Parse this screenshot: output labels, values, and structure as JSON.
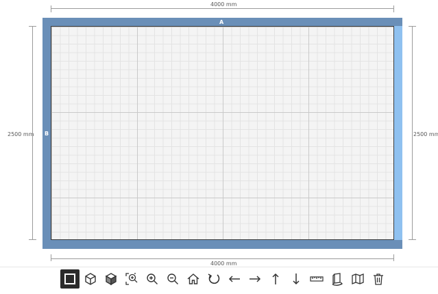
{
  "dimensions": {
    "top": "4000 mm",
    "bottom": "4000 mm",
    "left": "2500 mm",
    "right": "2500 mm"
  },
  "walls": {
    "top_label": "A",
    "left_label": "B",
    "color": "#6a8fb8",
    "selected_color": "#8fc1f0"
  },
  "toolbar": {
    "tools": [
      {
        "icon": "square-2d-view-icon",
        "active": true
      },
      {
        "icon": "cube-outline-icon",
        "active": false
      },
      {
        "icon": "cube-solid-icon",
        "active": false
      },
      {
        "icon": "zoom-fit-icon",
        "active": false
      },
      {
        "icon": "zoom-in-icon",
        "active": false
      },
      {
        "icon": "zoom-out-icon",
        "active": false
      },
      {
        "icon": "home-icon",
        "active": false
      },
      {
        "icon": "rotate-icon",
        "active": false
      },
      {
        "icon": "arrow-left-icon",
        "active": false
      },
      {
        "icon": "arrow-right-icon",
        "active": false
      },
      {
        "icon": "arrow-up-icon",
        "active": false
      },
      {
        "icon": "arrow-down-icon",
        "active": false
      },
      {
        "icon": "ruler-icon",
        "active": false
      },
      {
        "icon": "wall-rotate-icon",
        "active": false
      },
      {
        "icon": "map-icon",
        "active": false
      },
      {
        "icon": "trash-icon",
        "active": false
      }
    ]
  }
}
